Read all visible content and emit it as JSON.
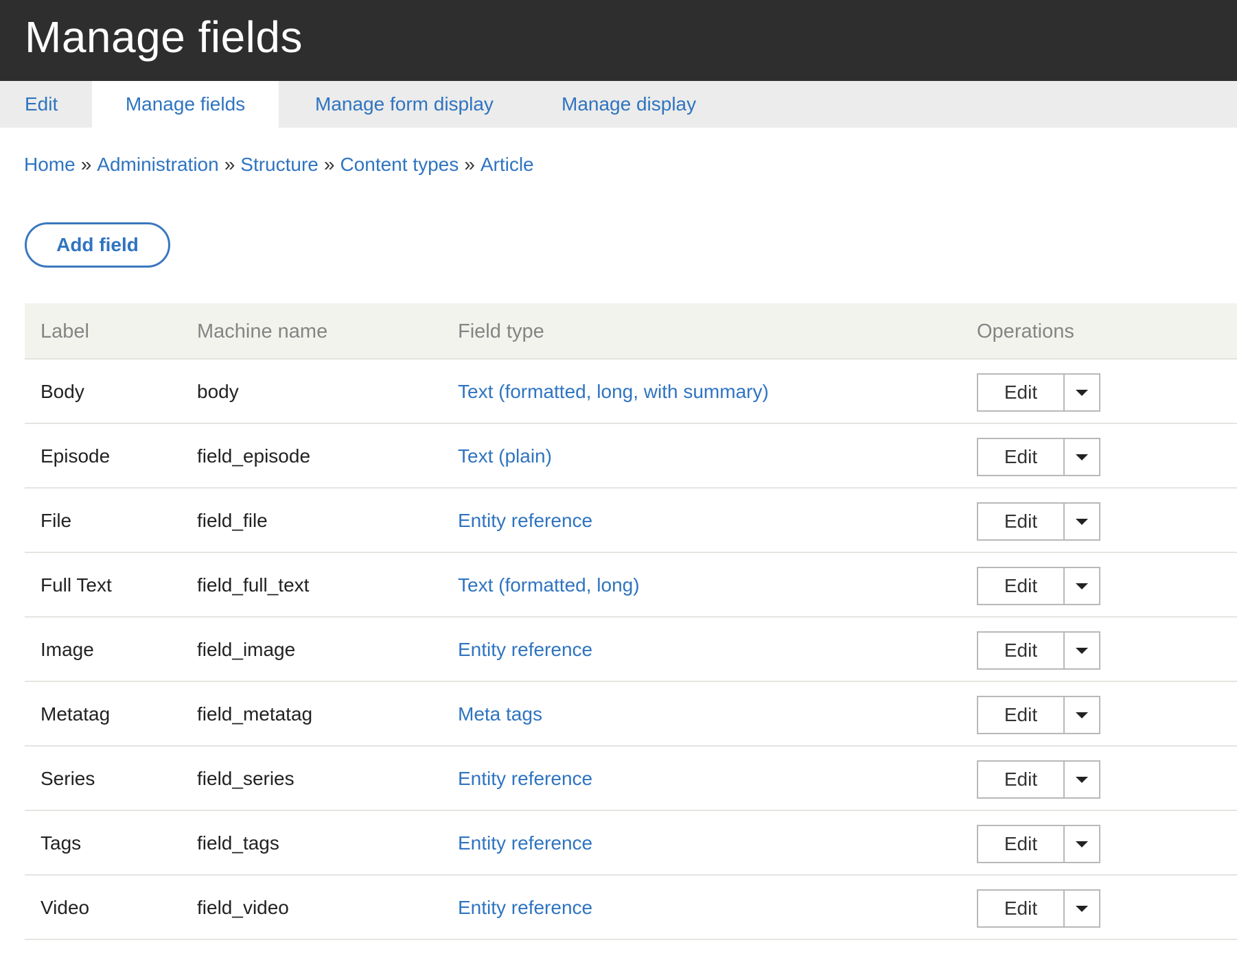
{
  "header": {
    "title": "Manage fields"
  },
  "tabs": [
    {
      "label": "Edit",
      "active": false
    },
    {
      "label": "Manage fields",
      "active": true
    },
    {
      "label": "Manage form display",
      "active": false
    },
    {
      "label": "Manage display",
      "active": false
    }
  ],
  "breadcrumb": {
    "separator": "»",
    "items": [
      "Home",
      "Administration",
      "Structure",
      "Content types",
      "Article"
    ]
  },
  "add_field_label": "Add field",
  "table": {
    "headers": {
      "label": "Label",
      "machine": "Machine name",
      "type": "Field type",
      "ops": "Operations"
    },
    "rows": [
      {
        "label": "Body",
        "machine": "body",
        "type": "Text (formatted, long, with summary)",
        "op": "Edit"
      },
      {
        "label": "Episode",
        "machine": "field_episode",
        "type": "Text (plain)",
        "op": "Edit"
      },
      {
        "label": "File",
        "machine": "field_file",
        "type": "Entity reference",
        "op": "Edit"
      },
      {
        "label": "Full Text",
        "machine": "field_full_text",
        "type": "Text (formatted, long)",
        "op": "Edit"
      },
      {
        "label": "Image",
        "machine": "field_image",
        "type": "Entity reference",
        "op": "Edit"
      },
      {
        "label": "Metatag",
        "machine": "field_metatag",
        "type": "Meta tags",
        "op": "Edit"
      },
      {
        "label": "Series",
        "machine": "field_series",
        "type": "Entity reference",
        "op": "Edit"
      },
      {
        "label": "Tags",
        "machine": "field_tags",
        "type": "Entity reference",
        "op": "Edit"
      },
      {
        "label": "Video",
        "machine": "field_video",
        "type": "Entity reference",
        "op": "Edit"
      }
    ]
  },
  "colors": {
    "header_bg": "#2e2e2e",
    "link": "#2f74c0",
    "tab_bar_bg": "#ececec",
    "table_head_bg": "#f3f3ee"
  }
}
